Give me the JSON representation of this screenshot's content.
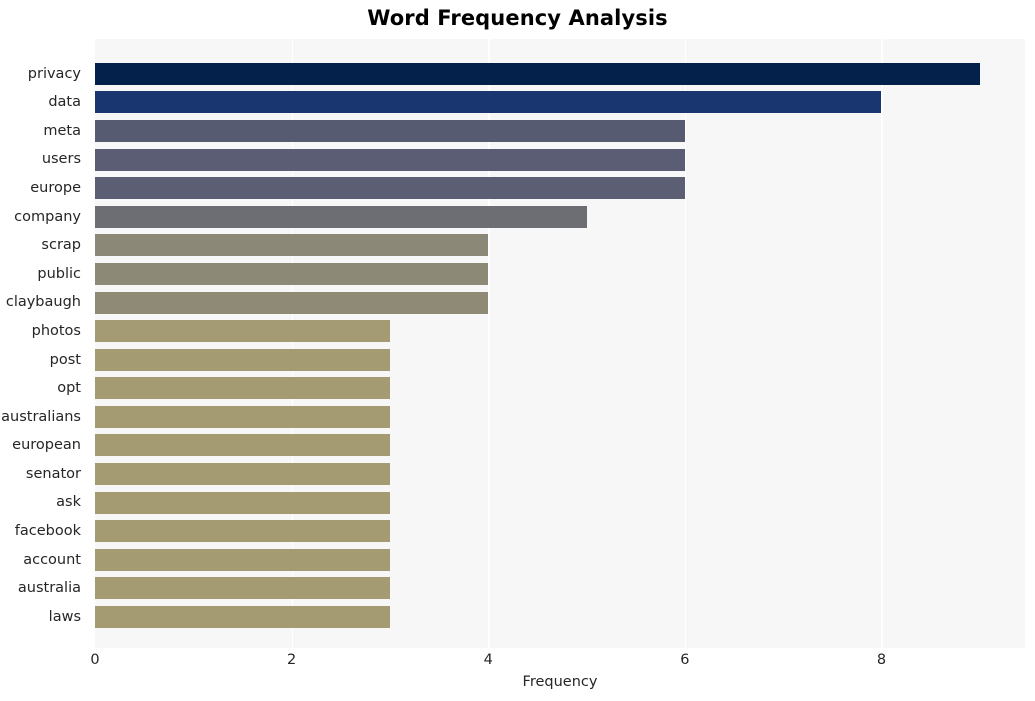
{
  "chart_data": {
    "type": "bar",
    "orientation": "horizontal",
    "title": "Word Frequency Analysis",
    "xlabel": "Frequency",
    "ylabel": "",
    "xlim": [
      0,
      9.46
    ],
    "xticks": [
      0,
      2,
      4,
      6,
      8
    ],
    "xticklabels": [
      "0",
      "2",
      "4",
      "6",
      "8"
    ],
    "grid": "vertical-white-on-light-gray",
    "legend": "none",
    "categories": [
      "privacy",
      "data",
      "meta",
      "users",
      "europe",
      "company",
      "scrap",
      "public",
      "claybaugh",
      "photos",
      "post",
      "opt",
      "australians",
      "european",
      "senator",
      "ask",
      "facebook",
      "account",
      "australia",
      "laws"
    ],
    "values": [
      9,
      8,
      6,
      6,
      6,
      5,
      4,
      4,
      4,
      3,
      3,
      3,
      3,
      3,
      3,
      3,
      3,
      3,
      3,
      3
    ],
    "bar_colors": [
      "#04214b",
      "#1a3670",
      "#575b72",
      "#5a5d73",
      "#5c5f74",
      "#6d6e73",
      "#8b8878",
      "#8d8977",
      "#8e8a76",
      "#a49a73",
      "#a59b73",
      "#a59b73",
      "#a59b73",
      "#a59b73",
      "#a59b73",
      "#a59b73",
      "#a59b73",
      "#a59b73",
      "#a59b73",
      "#a59b73"
    ]
  },
  "style": {
    "figure_background": "#ffffff",
    "plot_background": "#f7f7f7",
    "gridline_color": "#ffffff",
    "text_color": "#262626",
    "title_color": "#000000"
  }
}
